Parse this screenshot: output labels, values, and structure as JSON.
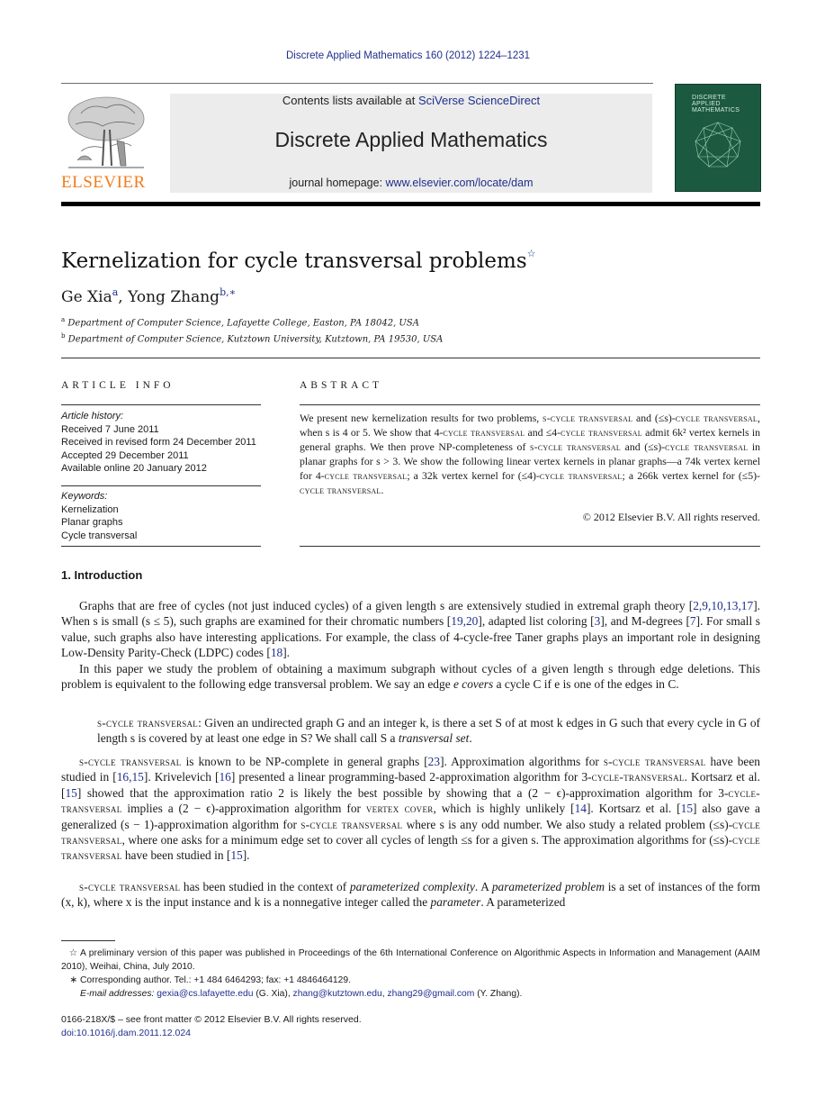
{
  "running_head": "Discrete Applied Mathematics 160 (2012) 1224–1231",
  "publisher": {
    "name": "ELSEVIER",
    "logo_icon": "elsevier-tree-logo",
    "brand_color": "#f07d1e"
  },
  "masthead": {
    "contents_prefix": "Contents lists available at ",
    "contents_link": "SciVerse ScienceDirect",
    "journal_name": "Discrete Applied Mathematics",
    "homepage_prefix": "journal homepage: ",
    "homepage_link": "www.elsevier.com/locate/dam",
    "background_color": "#ececec",
    "link_color": "#1f2f8c"
  },
  "cover": {
    "title_lines": [
      "DISCRETE",
      "APPLIED",
      "MATHEMATICS"
    ],
    "color": "#1b5a40"
  },
  "title": "Kernelization for cycle transversal problems",
  "title_mark": "☆",
  "authors": [
    {
      "name": "Ge Xia",
      "marks": "a"
    },
    {
      "name": "Yong Zhang",
      "marks": "b,∗"
    }
  ],
  "affiliations": [
    {
      "mark": "a",
      "text": "Department of Computer Science, Lafayette College, Easton, PA 18042, USA"
    },
    {
      "mark": "b",
      "text": "Department of Computer Science, Kutztown University, Kutztown, PA 19530, USA"
    }
  ],
  "article_info": {
    "heading": "ARTICLE INFO",
    "history_label": "Article history:",
    "history": [
      "Received 7 June 2011",
      "Received in revised form 24 December 2011",
      "Accepted 29 December 2011",
      "Available online 20 January 2012"
    ],
    "keywords_label": "Keywords:",
    "keywords": [
      "Kernelization",
      "Planar graphs",
      "Cycle transversal"
    ]
  },
  "abstract": {
    "heading": "ABSTRACT",
    "segments": [
      "We present new kernelization results for two problems, ",
      "s-cycle transversal",
      " and (≤s)-",
      "cycle transversal",
      ", when s is 4 or 5. We show that 4-",
      "cycle transversal",
      " and ≤4-",
      "cycle transversal",
      " admit 6k² vertex kernels in general graphs. We then prove NP-completeness of ",
      "s-cycle transversal",
      " and (≤s)-",
      "cycle transversal",
      " in planar graphs for s > 3. We show the following linear vertex kernels in planar graphs—a 74k vertex kernel for 4-",
      "cycle transversal",
      "; a 32k vertex kernel for (≤4)-",
      "cycle transversal",
      "; a 266k vertex kernel for (≤5)-",
      "cycle transversal",
      "."
    ],
    "copyright": "© 2012 Elsevier B.V. All rights reserved."
  },
  "section": {
    "heading": "1.  Introduction",
    "para1": {
      "a": "Graphs that are free of cycles (not just induced cycles) of a given length s are extensively studied in extremal graph theory [",
      "refs1": "2,9,10,13,17",
      "b": "]. When s is small (s ≤ 5), such graphs are examined for their chromatic numbers [",
      "refs2": "19,20",
      "c": "], adapted list coloring [",
      "refs3": "3",
      "d": "], and M-degrees [",
      "refs4": "7",
      "e": "]. For small s value, such graphs also have interesting applications. For example, the class of 4-cycle-free Taner graphs plays an important role in designing Low-Density Parity-Check (LDPC) codes [",
      "refs5": "18",
      "f": "]."
    },
    "para2": {
      "a": "In this paper we study the problem of obtaining a maximum subgraph without cycles of a given length s through edge deletions. This problem is equivalent to the following edge transversal problem. We say an edge ",
      "em": "e covers",
      "b": " a cycle C if e is one of the edges in C."
    },
    "definition": {
      "term": "s-cycle transversal",
      "a": ": Given an undirected graph G and an integer k, is there a set S of at most k edges in G such that every cycle in G of length s is covered by at least one edge in S? We shall call S a ",
      "em": "transversal set",
      "b": "."
    },
    "para3": {
      "t1": "s-cycle transversal",
      "a": " is known to be NP-complete in general graphs [",
      "r1": "23",
      "b": "]. Approximation algorithms for ",
      "t2": "s-cycle transversal",
      "c": " have been studied in [",
      "r2": "16,15",
      "d": "]. Krivelevich [",
      "r3": "16",
      "e": "] presented a linear programming-based 2-approximation algorithm for 3-",
      "t3": "cycle-transversal",
      "f": ". Kortsarz et al. [",
      "r4": "15",
      "g": "] showed that the approximation ratio 2 is likely the best possible by showing that a (2 − ϵ)-approximation algorithm for 3-",
      "t4": "cycle-transversal",
      "h": " implies a (2 − ϵ)-approximation algorithm for ",
      "t5": "vertex cover",
      "i": ", which is highly unlikely [",
      "r5": "14",
      "j": "]. Kortsarz et al. [",
      "r6": "15",
      "k": "] also gave a generalized (s − 1)-approximation algorithm for ",
      "t6": "s-cycle transversal",
      "l": " where s is any odd number. We also study a related problem (≤s)-",
      "t7": "cycle transversal",
      "m": ", where one asks for a minimum edge set to cover all cycles of length ≤s for a given s. The approximation algorithms for (≤s)-",
      "t8": "cycle transversal",
      "n": " have been studied in [",
      "r7": "15",
      "o": "]."
    },
    "para4": {
      "t1": "s-cycle transversal",
      "a": " has been studied in the context of ",
      "em1": "parameterized complexity",
      "b": ". A ",
      "em2": "parameterized problem",
      "c": " is a set of instances of the form (x, k), where x is the input instance and k is a nonnegative integer called the ",
      "em3": "parameter",
      "d": ". A parameterized"
    }
  },
  "footnotes": {
    "star_mark": "☆",
    "star_text": "A preliminary version of this paper was published in Proceedings of the 6th International Conference on Algorithmic Aspects in Information and Management (AAIM 2010), Weihai, China, July 2010.",
    "corr_mark": "∗",
    "corr_text": "Corresponding author. Tel.: +1 484 6464293; fax: +1 4846464129.",
    "email_label": "E-mail addresses:",
    "email1": "gexia@cs.lafayette.edu",
    "email1_owner": " (G. Xia), ",
    "email2": "zhang@kutztown.edu",
    "sep": ", ",
    "email3": "zhang29@gmail.com",
    "email3_owner": " (Y. Zhang)."
  },
  "front_matter": {
    "issn_line": "0166-218X/$ – see front matter © 2012 Elsevier B.V. All rights reserved.",
    "doi": "doi:10.1016/j.dam.2011.12.024"
  }
}
